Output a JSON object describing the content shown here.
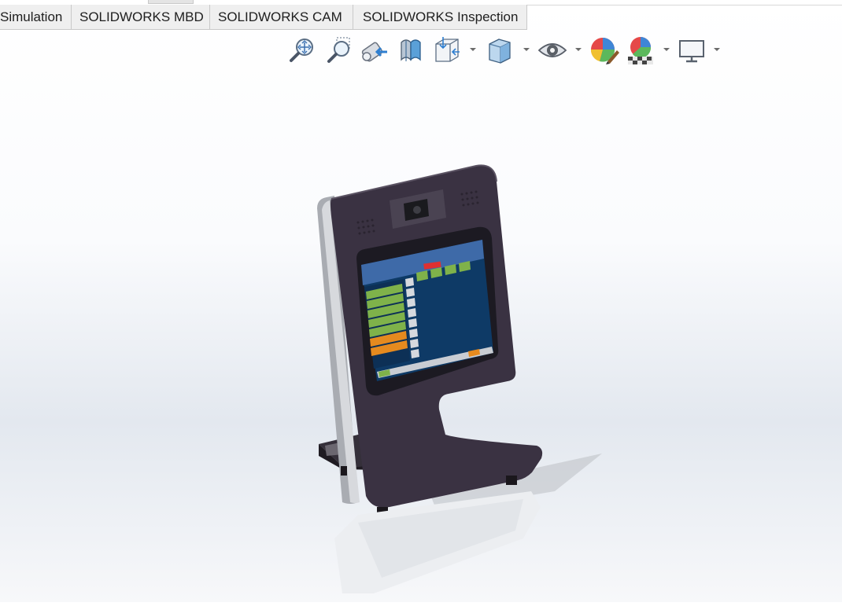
{
  "tabs": [
    {
      "label": "Simulation"
    },
    {
      "label": "SOLIDWORKS MBD"
    },
    {
      "label": "SOLIDWORKS CAM"
    },
    {
      "label": "SOLIDWORKS Inspection"
    }
  ],
  "view_toolbar": {
    "tools": [
      {
        "icon": "zoom-to-fit-icon"
      },
      {
        "icon": "zoom-to-area-icon"
      },
      {
        "icon": "previous-view-icon"
      },
      {
        "icon": "section-view-icon"
      },
      {
        "icon": "view-orientation-icon"
      },
      {
        "icon": "display-style-icon"
      },
      {
        "icon": "hide-show-items-icon"
      },
      {
        "icon": "edit-appearance-icon"
      },
      {
        "icon": "apply-scene-icon"
      },
      {
        "icon": "view-settings-icon"
      }
    ]
  },
  "model": {
    "description_icon": "kiosk-terminal-model",
    "body_color": "#3a3242",
    "screen_color": "#0e3a66",
    "accent_green": "#7fb24a",
    "accent_orange": "#e58a1f"
  }
}
